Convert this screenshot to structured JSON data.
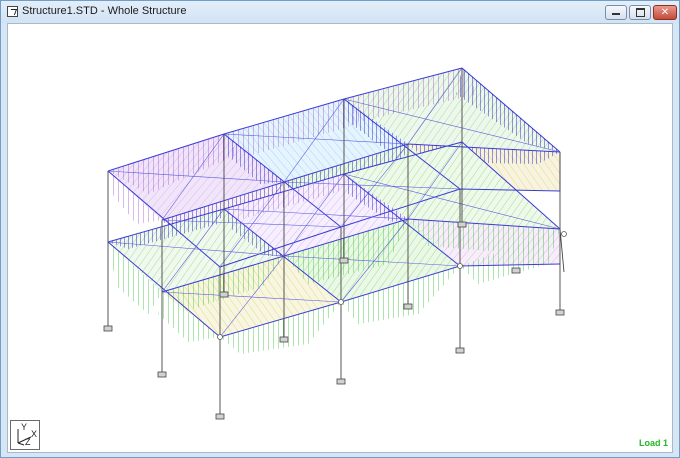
{
  "window": {
    "title": "Structure1.STD - Whole Structure",
    "controls": {
      "minimize": "minimize",
      "maximize": "maximize",
      "close": "✕"
    }
  },
  "viewport": {
    "axis_indicator": {
      "y": "Y",
      "x": "X",
      "z": "Z"
    },
    "load_label": "Load 1"
  },
  "colors": {
    "beam": "#3b3bd6",
    "column": "#333333",
    "hatch_blue": "#1818c8",
    "hatch_purple": "#9a52c9",
    "hatch_green": "#30c030",
    "hatch_yellow": "#c9c34a",
    "hatch_cyan": "#6ab8e0",
    "load_text": "#23b823"
  }
}
